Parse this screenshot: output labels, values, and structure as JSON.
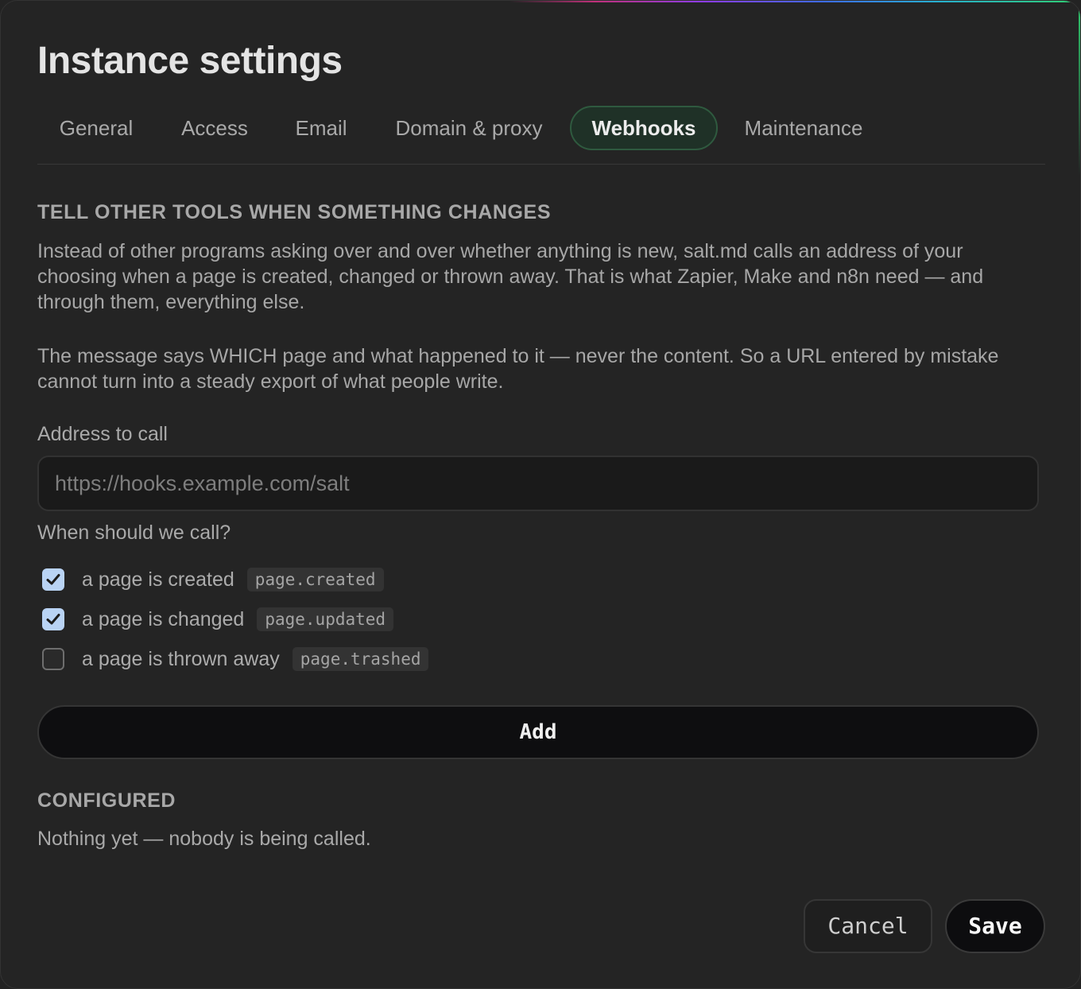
{
  "dialog": {
    "title": "Instance settings",
    "tabs": [
      {
        "label": "General",
        "active": false
      },
      {
        "label": "Access",
        "active": false
      },
      {
        "label": "Email",
        "active": false
      },
      {
        "label": "Domain & proxy",
        "active": false
      },
      {
        "label": "Webhooks",
        "active": true
      },
      {
        "label": "Maintenance",
        "active": false
      }
    ]
  },
  "webhooks": {
    "heading": "TELL OTHER TOOLS WHEN SOMETHING CHANGES",
    "intro": "Instead of other programs asking over and over whether anything is new, salt.md calls an address of your choosing when a page is created, changed or thrown away. That is what Zapier, Make and n8n need — and through them, everything else.",
    "privacy_note": "The message says WHICH page and what happened to it — never the content. So a URL entered by mistake cannot turn into a steady export of what people write.",
    "address_label": "Address to call",
    "address_placeholder": "https://hooks.example.com/salt",
    "address_value": "",
    "events_label": "When should we call?",
    "events": [
      {
        "label": "a page is created",
        "code": "page.created",
        "checked": true
      },
      {
        "label": "a page is changed",
        "code": "page.updated",
        "checked": true
      },
      {
        "label": "a page is thrown away",
        "code": "page.trashed",
        "checked": false
      }
    ],
    "add_label": "Add",
    "configured_heading": "CONFIGURED",
    "configured_empty": "Nothing yet — nobody is being called."
  },
  "footer": {
    "cancel_label": "Cancel",
    "save_label": "Save"
  },
  "colors": {
    "background": "#242424",
    "active_tab_bg": "#1f3127",
    "active_tab_border": "#2f5a3f",
    "checkbox_on": "#b9d3f4"
  }
}
